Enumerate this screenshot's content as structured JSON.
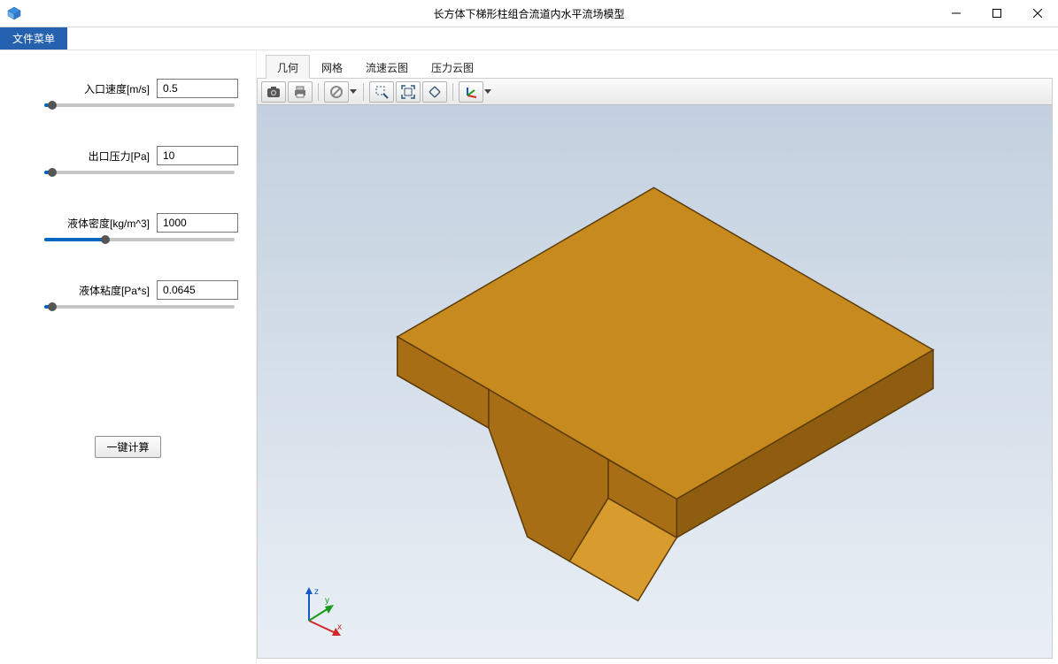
{
  "window": {
    "title": "长方体下梯形柱组合流道内水平流场模型"
  },
  "menu": {
    "file_label": "文件菜单"
  },
  "params": [
    {
      "label": "入口速度[m/s]",
      "value": "0.5",
      "slider_pct": 4
    },
    {
      "label": "出口压力[Pa]",
      "value": "10",
      "slider_pct": 4
    },
    {
      "label": "液体密度[kg/m^3]",
      "value": "1000",
      "slider_pct": 32
    },
    {
      "label": "液体粘度[Pa*s]",
      "value": "0.0645",
      "slider_pct": 4
    }
  ],
  "compute_button_label": "一键计算",
  "tabs": [
    {
      "label": "几何",
      "active": true
    },
    {
      "label": "网格",
      "active": false
    },
    {
      "label": "流速云图",
      "active": false
    },
    {
      "label": "压力云图",
      "active": false
    }
  ],
  "toolbar_icons": [
    "camera-icon",
    "print-icon",
    "sep",
    "cancel-icon",
    "caret",
    "sep",
    "zoom-select-icon",
    "fit-view-icon",
    "reset-view-icon",
    "sep",
    "axis-triad-icon",
    "caret"
  ],
  "triad": {
    "x": "x",
    "y": "y",
    "z": "z"
  },
  "colors": {
    "accent": "#2561ae",
    "slider_fill": "#0067c0",
    "model_top": "#c78a1e",
    "model_side_right": "#8f5d0f",
    "model_side_left": "#a86e15"
  }
}
